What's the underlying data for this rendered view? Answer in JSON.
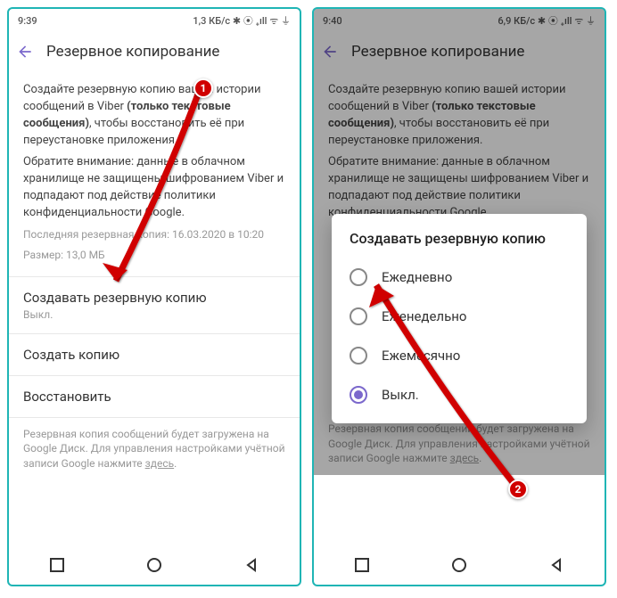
{
  "left": {
    "status": {
      "time": "9:39",
      "icons": "◁ ✈ ⚙ ⚙ ⚙",
      "net": "1,3 КБ/с ✱ ⦿ ₊ıll ᯤ ⏚"
    },
    "header": {
      "title": "Резервное копирование"
    },
    "body": {
      "p1a": "Создайте резервную копию вашей истории сообщений в Viber ",
      "p1b": "(только текстовые сообщения)",
      "p1c": ", чтобы восстановить её при переустановке приложения.",
      "p2": "Обратите внимание: данные в облачном хранилище не защищены шифрованием Viber и подпадают под действие политики конфиденциальности Google.",
      "meta1": "Последняя резервная копия: 16.03.2020 в 10:20",
      "meta2": "Размер: 13,0 МБ"
    },
    "items": {
      "schedule": {
        "title": "Создавать резервную копию",
        "sub": "Выкл."
      },
      "create": {
        "title": "Создать копию"
      },
      "restore": {
        "title": "Восстановить"
      }
    },
    "footer": {
      "t1": "Резервная копия сообщений будет загружена на Google Диск. Для управления настройками учётной записи Google нажмите ",
      "link": "здесь",
      "t2": "."
    },
    "badge": "1"
  },
  "right": {
    "status": {
      "time": "9:40",
      "icons": "◁ ✈ ⚙ ⚙ ⚙",
      "net": "6,9 КБ/с ✱ ⦿ ₊ıll ᯤ ⏚"
    },
    "header": {
      "title": "Резервное копирование"
    },
    "body": {
      "p1a": "Создайте резервную копию вашей истории сообщений в Viber ",
      "p1b": "(только текстовые сообщения)",
      "p1c": ", чтобы восстановить её при переустановке приложения.",
      "p2": "Обратите внимание: данные в облачном хранилище не защищены шифрованием Viber и подпадают под действие политики конфиденциальности Google."
    },
    "dialog": {
      "title": "Создавать резервную копию",
      "options": [
        {
          "label": "Ежедневно",
          "selected": false
        },
        {
          "label": "Еженедельно",
          "selected": false
        },
        {
          "label": "Ежемесячно",
          "selected": false
        },
        {
          "label": "Выкл.",
          "selected": true
        }
      ]
    },
    "footer": {
      "t1": "Резервная копия сообщений будет загружена на Google Диск. Для управления настройками учётной записи Google нажмите ",
      "link": "здесь",
      "t2": "."
    },
    "badge": "2"
  }
}
